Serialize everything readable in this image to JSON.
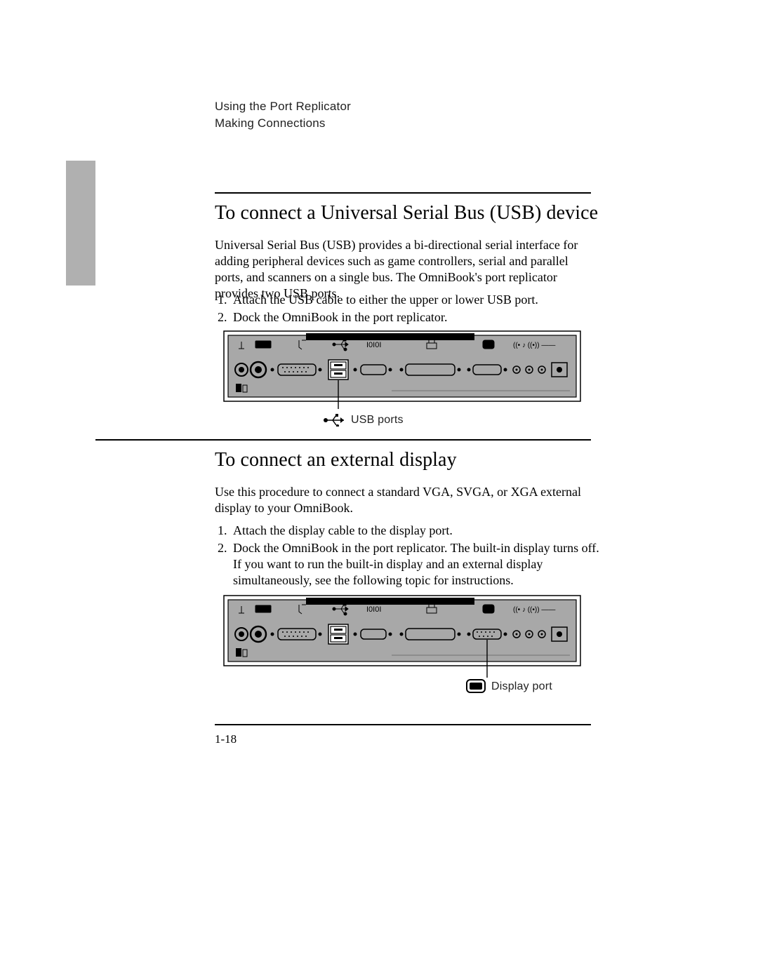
{
  "header": {
    "chapter": "Using the Port Replicator",
    "section": "Making Connections"
  },
  "section1": {
    "title": "To connect a Universal Serial Bus (USB) device",
    "intro": "Universal Serial Bus (USB) provides a bi-directional serial interface for adding peripheral devices such as game controllers, serial and parallel ports, and scanners on a single bus. The OmniBook's port replicator provides two USB ports.",
    "steps": [
      "Attach the USB cable to either the upper or lower USB port.",
      "Dock the OmniBook in the port replicator."
    ],
    "callout": "USB ports"
  },
  "section2": {
    "title": "To connect an external display",
    "intro": "Use this procedure to connect a standard VGA, SVGA, or XGA external display to your OmniBook.",
    "steps": [
      "Attach the display cable to the display port.",
      "Dock the OmniBook in the port replicator. The built-in display turns off. If you want to run the built-in display and an external display simultaneously, see the following topic for instructions."
    ],
    "callout": "Display port"
  },
  "page_number": "1-18"
}
